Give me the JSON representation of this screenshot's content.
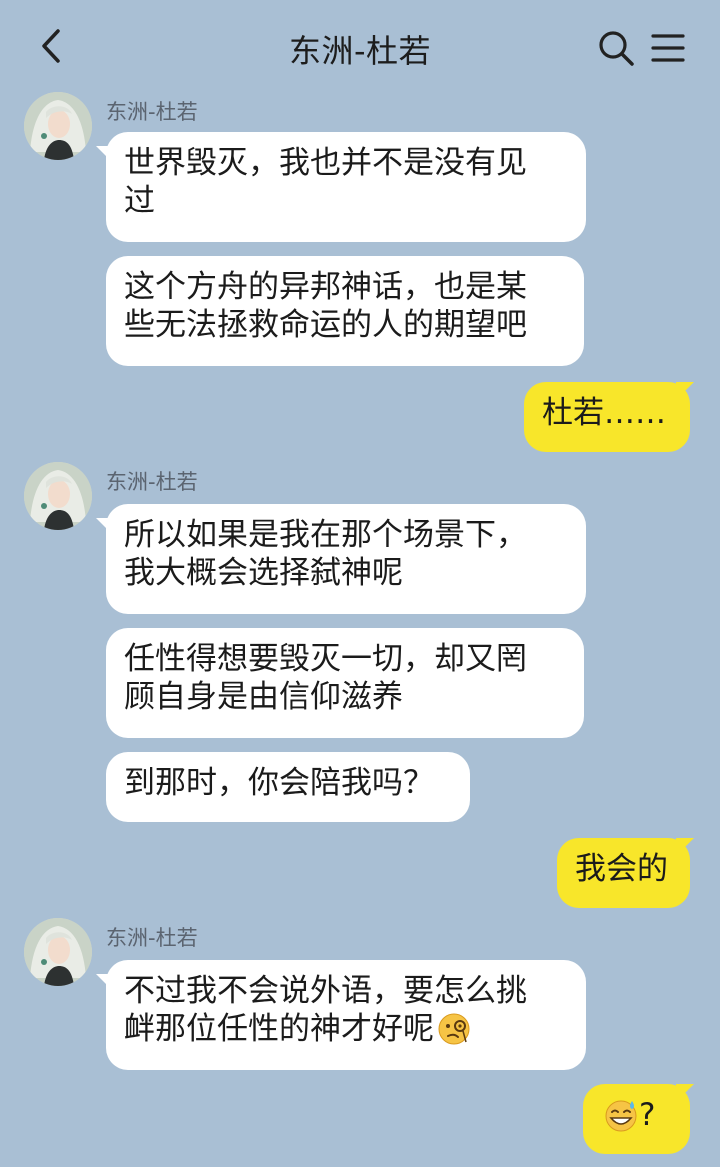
{
  "header": {
    "title": "东洲-杜若"
  },
  "messages": [
    {
      "side": "in",
      "sender": "东洲-杜若",
      "lines": [
        "世界毁灭，我也并不是没有见",
        "过"
      ]
    },
    {
      "side": "in",
      "lines": [
        "这个方舟的异邦神话，也是某",
        "些无法拯救命运的人的期望吧"
      ]
    },
    {
      "side": "out",
      "lines": [
        "杜若……"
      ]
    },
    {
      "side": "in",
      "sender": "东洲-杜若",
      "lines": [
        "所以如果是我在那个场景下，",
        "我大概会选择弑神呢"
      ]
    },
    {
      "side": "in",
      "lines": [
        "任性得想要毁灭一切，却又罔",
        "顾自身是由信仰滋养"
      ]
    },
    {
      "side": "in",
      "lines": [
        "到那时，你会陪我吗？"
      ]
    },
    {
      "side": "out",
      "lines": [
        "我会的"
      ]
    },
    {
      "side": "in",
      "sender": "东洲-杜若",
      "lines": [
        "不过我不会说外语，要怎么挑",
        "衅那位任性的神才好呢"
      ],
      "emoji": "monocle-face-emoji"
    },
    {
      "side": "out",
      "lines": [
        "?"
      ],
      "emoji": "grinning-sweat-emoji"
    }
  ],
  "colors": {
    "background": "#a9bfd4",
    "incoming_bubble": "#ffffff",
    "outgoing_bubble": "#f8e62a"
  }
}
